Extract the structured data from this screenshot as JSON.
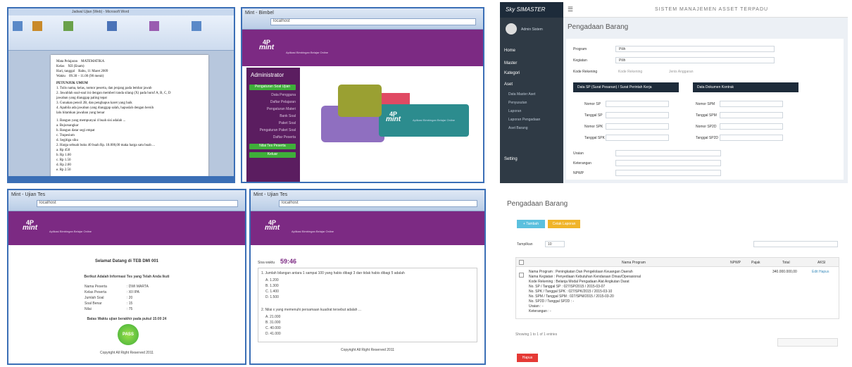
{
  "word": {
    "titlebar": "Jadwal Ujian (Web) - Microsoft Word",
    "info_labels": [
      "Mata Pelajaran",
      "Kelas",
      "Hari, tanggal",
      "Waktu"
    ],
    "info_values": [
      "MATEMATIKA",
      "XII (Enam)",
      "Rabu, 11 Maret 2009",
      "09.30 – 11.00 (90 menit)"
    ],
    "heading": "PETUNJUK UMUM",
    "lines": [
      "1. Tulis nama, kelas, nomor peserta, dan jenjang pada lembar jawab",
      "2. Jawablah soal-soal ini dengan memberi tanda silang (X) pada huruf A, B, C, D",
      "   jawaban yang dianggap paling tepat",
      "3. Gunakan pensil 2B, dan penghapus karet yang baik",
      "4. Apabila ada jawaban yang dianggap salah, hapuslah dengan bersih",
      "   lalu hitamkan jawaban yang benar",
      "",
      "1. Bangun yang mempunyai 4 buah sisi adalah ...",
      "   a. Bujursangkar",
      "   b. Bangun datar segi empat",
      "   c. Trapesium",
      "   d. Segitiga siku",
      "2. Harga sebuah buku 40 buah Rp. 18.000,00 maka harga satu buah ...",
      "   a. Rp 450",
      "   b. Rp 1.00",
      "   c. Rp 1.50",
      "   d. Rp 2.00",
      "   e. Rp 2.50"
    ]
  },
  "mint_admin": {
    "tab": "Mint - Bimbel",
    "address": "localhost",
    "banner": "Aplikasi Bimbingan Belajar Online",
    "logo_top": "4P",
    "logo_bottom": "mint",
    "admin_title": "Administrator",
    "menu": [
      "Pengaturan Soal Ujian",
      "Data Pengguna",
      "Daftar Pelajaran",
      "Pengaturan Materi",
      "Bank Soal",
      "Paket Soal",
      "Pengaturan Paket Soal",
      "Daftar Peserta",
      "Nilai Tes Peserta",
      "Keluar"
    ]
  },
  "aset": {
    "brand": "Sky SIMASTER",
    "system_title": "SISTEM MANAJEMEN ASSET TERPADU",
    "page_title": "Pengadaan Barang",
    "user_name": "Admin Sistem",
    "menu": [
      "Home",
      "Master",
      "Kategori",
      "Aset",
      "Data Master Aset",
      "Penyusutan",
      "Laporan",
      "Laporan Pengadaan",
      "Aset Barang",
      "Setting"
    ],
    "form_labels": [
      "Program",
      "Kegiatan",
      "Kode Rekening"
    ],
    "form_value": "Pilih",
    "rek_hint": "Kode Rekening",
    "rek_hint2": "Jenis Anggaran",
    "panel_left": "Data SP (Surat Pesanan) / Surat Perintah Kerja",
    "panel_right": "Data Dokumen Kontrak",
    "left_fields": [
      "Nomor SP",
      "Tanggal SP",
      "Nomor SPK",
      "Tanggal SPK"
    ],
    "right_fields": [
      "Nomor SPM",
      "Tanggal SPM",
      "Nomor SP2D",
      "Tanggal SP2D"
    ],
    "bottom_fields": [
      "Uraian",
      "Keterangan",
      "NPWP"
    ]
  },
  "pengadaan": {
    "title": "Pengadaan Barang",
    "btn_add": "+ Tambah",
    "btn_export": "Cetak Laporan",
    "show_label": "Tampilkan",
    "show_value": "10",
    "columns": [
      "Nama Program",
      "NPWP",
      "Pajak",
      "Total",
      "AKSI"
    ],
    "row_lines": [
      "Nama Program : Peningkatan Dan Pengelolaan Keuangan Daerah",
      "Nama Kegiatan : Penyediaan Kebutuhan Kendaraan Dinas/Operasional",
      "Kode Rekening : Belanja Modal Pengadaan Alat Angkutan Darat",
      "No. SP / Tanggal SP : 027/SP/2015 / 2015-03-07",
      "No. SPK / Tanggal SPK : 027/SPK/2015 / 2015-03-10",
      "No. SPM / Tanggal SPM : 027/SPM/2015 / 2015-03-20",
      "No. SP2D / Tanggal SP2D : -",
      "Uraian : -",
      "Keterangan : -"
    ],
    "row_total": "340.000.000,00",
    "row_actions": "Edit   Hapus",
    "footer_info": "Showing 1 to 1 of 1 entries",
    "btn_delete": "Hapus"
  },
  "mint_result": {
    "tab": "Mint - Ujian Tes",
    "heading": "Selamat Datang di TEB DMI 001",
    "subheading": "Berikut Adalah Informasi Tes yang Telah Anda Ikuti",
    "labels": [
      "Nama Peserta",
      "Kelas Peserta",
      "Jumlah Soal",
      "Soal Benar",
      "Nilai"
    ],
    "values": [
      ": DWI MARTA",
      ": XII IPA",
      ": 20",
      ": 15",
      ": 75"
    ],
    "deadline": "Batas Waktu ujian berakhir pada pukul 15:00 24",
    "badge": "PASS",
    "footer": "Copyright All Right Reserved 2011"
  },
  "mint_quiz": {
    "tab": "Mint - Ujian Tes",
    "timer_label": "Sisa waktu",
    "timer_value": "59:46",
    "q1": "1. Jumlah bilangan antara 1 sampai 100 yang habis dibagi 3 dan tidak habis dibagi 5 adalah",
    "q1_options": [
      "A. 1.200",
      "B. 1.300",
      "C. 1.400",
      "D. 1.500"
    ],
    "q2": "2. Nilai x yang memenuhi persamaan kuadrat tersebut adalah ...",
    "q2_options": [
      "A. 21.000",
      "B. 31.000",
      "C. 40.000",
      "D. 41.000"
    ],
    "footer": "Copyright All Right Reserved 2011"
  },
  "colors": {
    "purple": "#7c2a83",
    "teal": "#2c8c8e",
    "olive": "#9aa032",
    "pink": "#e04a63",
    "lilac": "#8f6fc0",
    "green": "#3fae3a",
    "navy": "#1d2b3a",
    "orange": "#f0b429",
    "red": "#e53935",
    "light_blue": "#5bc0de"
  }
}
